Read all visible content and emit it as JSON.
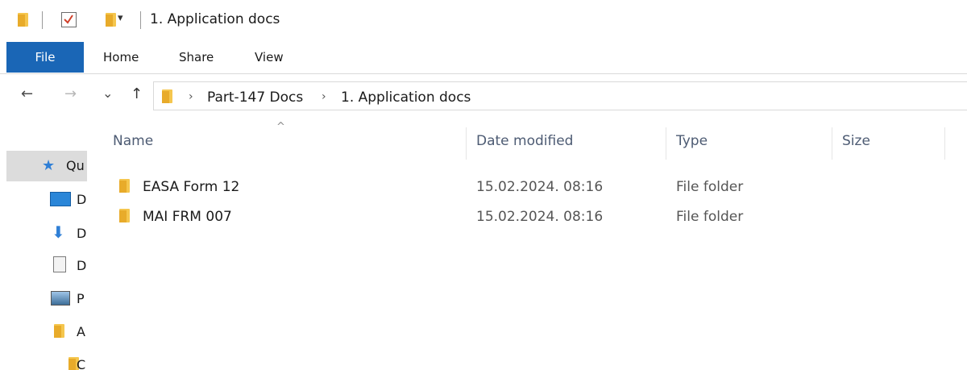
{
  "window": {
    "title": "1. Application docs"
  },
  "quick_access_toolbar": {
    "icons": [
      "folder-icon",
      "properties-checkbox-icon",
      "new-folder-icon",
      "customize-dropdown-icon"
    ]
  },
  "ribbon": {
    "tabs": [
      {
        "label": "File",
        "active": true
      },
      {
        "label": "Home"
      },
      {
        "label": "Share"
      },
      {
        "label": "View"
      }
    ]
  },
  "nav": {
    "back": "←",
    "forward": "→",
    "recent": "⌄",
    "up": "↑"
  },
  "address": {
    "breadcrumbs": [
      "Part-147 Docs",
      "1. Application docs"
    ],
    "separator": "›"
  },
  "sidebar": {
    "items": [
      {
        "label": "Qu",
        "icon": "star-icon",
        "selected": true
      },
      {
        "label": "D",
        "icon": "desktop-icon"
      },
      {
        "label": "D",
        "icon": "download-arrow-icon"
      },
      {
        "label": "D",
        "icon": "document-icon"
      },
      {
        "label": "P",
        "icon": "pictures-icon"
      },
      {
        "label": "A",
        "icon": "folder-icon"
      },
      {
        "label": "C",
        "icon": "folder-icon"
      }
    ]
  },
  "file_list": {
    "sort_indicator": "^",
    "columns": [
      "Name",
      "Date modified",
      "Type",
      "Size"
    ],
    "rows": [
      {
        "name": "EASA Form 12",
        "date": "15.02.2024. 08:16",
        "type": "File folder",
        "size": ""
      },
      {
        "name": "MAI FRM 007",
        "date": "15.02.2024. 08:16",
        "type": "File folder",
        "size": ""
      }
    ]
  },
  "colors": {
    "file_tab": "#1a66b6",
    "folder": "#f5c64e",
    "selection": "#dcdcdc"
  }
}
